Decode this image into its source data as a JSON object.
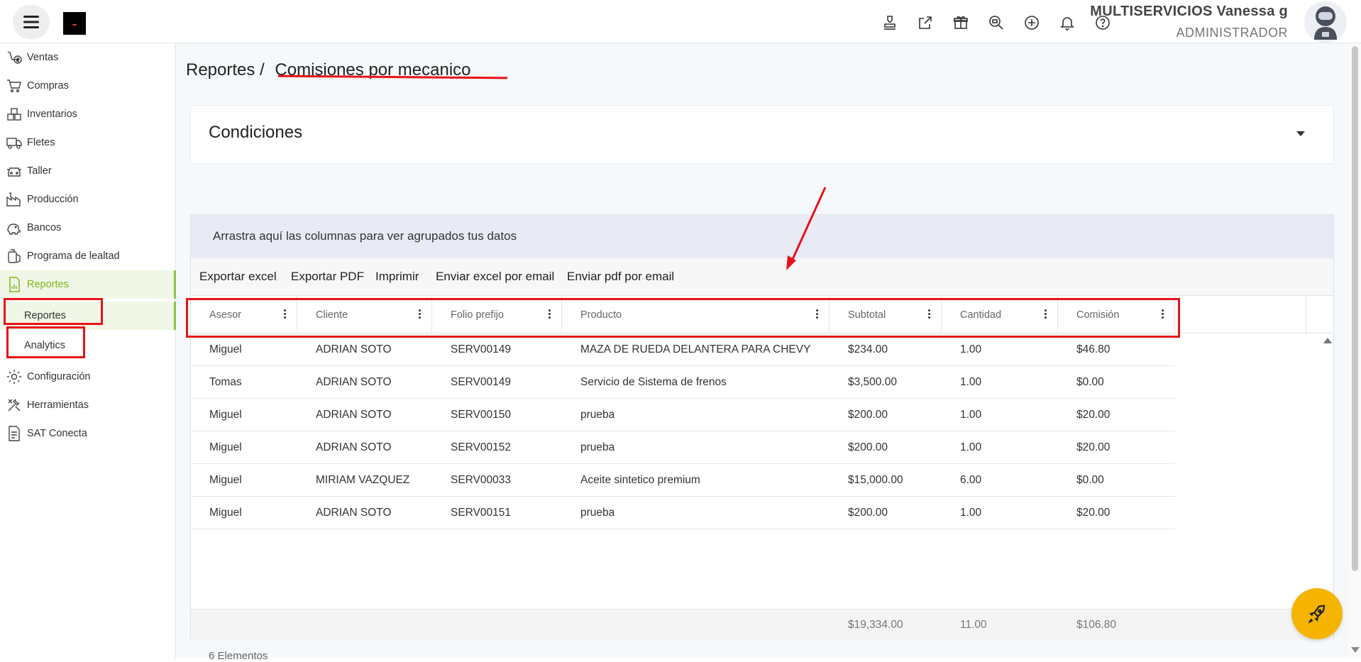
{
  "header": {
    "user_name": "MULTISERVICIOS Vanessa g",
    "user_role": "ADMINISTRADOR",
    "icons": [
      "stamp-icon",
      "external-link-icon",
      "gift-icon",
      "search-zoom-icon",
      "add-circle-icon",
      "bell-icon",
      "help-icon"
    ]
  },
  "sidebar": {
    "items": [
      {
        "label": "Ventas",
        "icon": "sales-icon"
      },
      {
        "label": "Compras",
        "icon": "cart-icon"
      },
      {
        "label": "Inventarios",
        "icon": "boxes-icon"
      },
      {
        "label": "Fletes",
        "icon": "truck-icon"
      },
      {
        "label": "Taller",
        "icon": "car-icon"
      },
      {
        "label": "Producción",
        "icon": "factory-icon"
      },
      {
        "label": "Bancos",
        "icon": "piggy-bank-icon"
      },
      {
        "label": "Programa de lealtad",
        "icon": "loyalty-icon"
      },
      {
        "label": "Reportes",
        "icon": "report-icon"
      },
      {
        "label": "Configuración",
        "icon": "gear-icon"
      },
      {
        "label": "Herramientas",
        "icon": "tools-icon"
      },
      {
        "label": "SAT Conecta",
        "icon": "document-icon"
      }
    ],
    "subitems": [
      {
        "label": "Reportes"
      },
      {
        "label": "Analytics"
      }
    ]
  },
  "page": {
    "breadcrumb_root": "Reportes /",
    "breadcrumb_current": "Comisiones por mecanico"
  },
  "conditions": {
    "title": "Condiciones"
  },
  "grid": {
    "group_hint": "Arrastra aquí las columnas para ver agrupados tus datos",
    "toolbar": [
      "Exportar excel",
      "Exportar PDF",
      "Imprimir",
      "Enviar excel por email",
      "Enviar pdf por email"
    ],
    "columns": [
      "Asesor",
      "Cliente",
      "Folio prefijo",
      "Producto",
      "Subtotal",
      "Cantidad",
      "Comisión"
    ],
    "rows": [
      [
        "Miguel",
        "ADRIAN SOTO",
        "SERV00149",
        "MAZA DE RUEDA DELANTERA PARA CHEVY",
        "$234.00",
        "1.00",
        "$46.80"
      ],
      [
        "Tomas",
        "ADRIAN SOTO",
        "SERV00149",
        "Servicio de Sistema de frenos",
        "$3,500.00",
        "1.00",
        "$0.00"
      ],
      [
        "Miguel",
        "ADRIAN SOTO",
        "SERV00150",
        "prueba",
        "$200.00",
        "1.00",
        "$20.00"
      ],
      [
        "Miguel",
        "ADRIAN SOTO",
        "SERV00152",
        "prueba",
        "$200.00",
        "1.00",
        "$20.00"
      ],
      [
        "Miguel",
        "MIRIAM VAZQUEZ",
        "SERV00033",
        "Aceite sintetico premium",
        "$15,000.00",
        "6.00",
        "$0.00"
      ],
      [
        "Miguel",
        "ADRIAN SOTO",
        "SERV00151",
        "prueba",
        "$200.00",
        "1.00",
        "$20.00"
      ]
    ],
    "totals": {
      "subtotal": "$19,334.00",
      "cantidad": "11.00",
      "comision": "$106.80"
    },
    "elements_count": "6 Elementos"
  },
  "colors": {
    "accent_green": "#7cb518",
    "annotation_red": "#e8121a",
    "fab_yellow": "#f5b400"
  }
}
